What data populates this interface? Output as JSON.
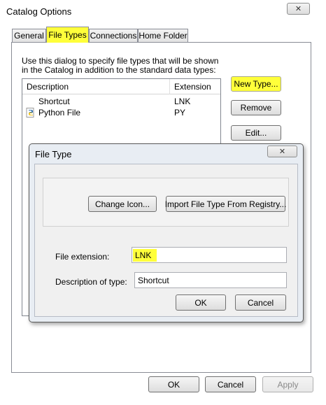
{
  "window": {
    "title": "Catalog Options",
    "close_icon": "close-icon"
  },
  "tabs": [
    {
      "label": "General"
    },
    {
      "label": "File Types",
      "active": true
    },
    {
      "label": "Connections"
    },
    {
      "label": "Home Folder"
    }
  ],
  "file_types": {
    "instructions": "Use this dialog to specify file types that will be shown in the Catalog in addition to the standard data types:",
    "instructions_line1": "Use this dialog to specify file types that will be shown",
    "instructions_line2": "in the Catalog in addition to the standard data types:",
    "columns": [
      "Description",
      "Extension"
    ],
    "rows": [
      {
        "description": "Shortcut",
        "extension": "LNK",
        "icon": "none"
      },
      {
        "description": "Python File",
        "extension": "PY",
        "icon": "python-file-icon"
      }
    ],
    "buttons": {
      "new_type": "New Type...",
      "remove": "Remove",
      "edit": "Edit..."
    }
  },
  "file_type_dialog": {
    "title": "File Type",
    "change_icon": "Change Icon...",
    "import": "Import File Type From Registry...",
    "extension_label": "File extension:",
    "extension_value": "LNK",
    "description_label": "Description of type:",
    "description_value": "Shortcut",
    "ok": "OK",
    "cancel": "Cancel"
  },
  "footer": {
    "ok": "OK",
    "cancel": "Cancel",
    "apply": "Apply"
  },
  "colors": {
    "highlight": "#ffff3a",
    "dialog_frame": "#e8edf3"
  }
}
